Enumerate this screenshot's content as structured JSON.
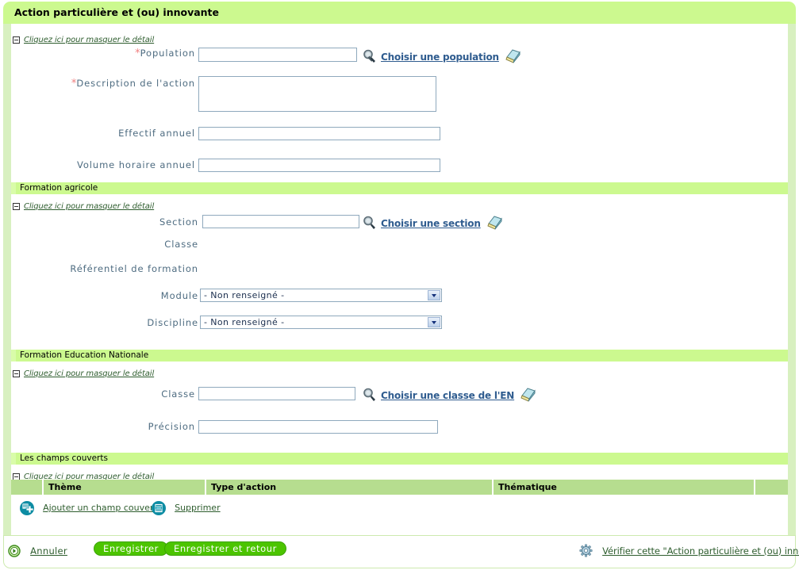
{
  "header": {
    "title": "Action particulière et (ou) innovante"
  },
  "common": {
    "collapse_label": "Cliquez ici pour masquer le détail",
    "required_marker": "*"
  },
  "sections": {
    "main": {
      "collapse_label": "Cliquez ici pour masquer le détail",
      "fields": {
        "population": {
          "label": "Population",
          "required": true,
          "value": "",
          "chooser_label": "Choisir une population"
        },
        "description": {
          "label": "Description de l'action",
          "required": true,
          "value": ""
        },
        "effectif": {
          "label": "Effectif annuel",
          "required": false,
          "value": ""
        },
        "volume": {
          "label": "Volume horaire annuel",
          "required": false,
          "value": ""
        }
      }
    },
    "formation_agricole": {
      "title": "Formation agricole",
      "collapse_label": "Cliquez ici pour masquer le détail",
      "fields": {
        "section": {
          "label": "Section",
          "value": "",
          "chooser_label": "Choisir une section"
        },
        "classe": {
          "label": "Classe",
          "value": ""
        },
        "referentiel": {
          "label": "Référentiel de formation",
          "value": ""
        },
        "module": {
          "label": "Module",
          "value": "- Non renseigné -"
        },
        "discipline": {
          "label": "Discipline",
          "value": "- Non renseigné -"
        }
      }
    },
    "formation_en": {
      "title": "Formation Education Nationale",
      "collapse_label": "Cliquez ici pour masquer le détail",
      "fields": {
        "classe": {
          "label": "Classe",
          "value": "",
          "chooser_label": "Choisir une classe de l'EN"
        },
        "precision": {
          "label": "Précision",
          "value": ""
        }
      }
    },
    "champs_couverts": {
      "title": "Les champs couverts",
      "collapse_label": "Cliquez ici pour masquer le détail",
      "table": {
        "columns": [
          "",
          "Thème",
          "Type d'action",
          "Thématique",
          ""
        ],
        "rows": []
      },
      "actions": {
        "add_label": "Ajouter un champ couvert",
        "delete_label": "Supprimer"
      }
    }
  },
  "footer": {
    "cancel_label": "Annuler",
    "save_label": "Enregistrer",
    "save_return_label": "Enregistrer et retour",
    "verify_label": "Vérifier cette \"Action particulière et (ou) innovante\""
  },
  "colors": {
    "header_green": "#ccf98f",
    "section_green": "#ccf98f",
    "frame_green": "#d8f0c0",
    "table_header_green": "#b6dd8f",
    "button_green": "#4cc400",
    "link_blue": "#2f5c8f",
    "link_green": "#2e5d2e",
    "label_blue": "#4d6b80",
    "input_border": "#8fa9bd",
    "required_red": "#f08080",
    "icon_teal": "#0d8ca3"
  }
}
